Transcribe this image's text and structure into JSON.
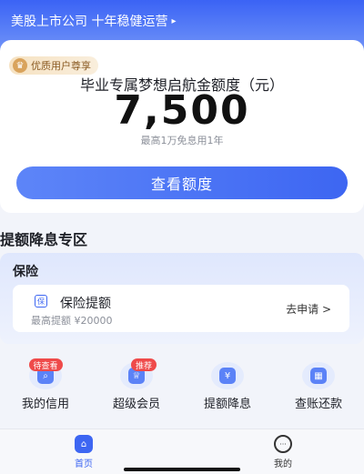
{
  "banner": {
    "text": "美股上市公司 十年稳健运营",
    "arrow": "▸"
  },
  "quota_card": {
    "badge": "优质用户尊享",
    "title": "毕业专属梦想启航金额度（元）",
    "amount": "7,500",
    "subtitle": "最高1万免息用1年",
    "button": "查看额度"
  },
  "section": {
    "title": "提额降息专区"
  },
  "insurance": {
    "panel_title": "保险",
    "item_name": "保险提额",
    "max_text": "最高提额 ¥20000",
    "apply": "去申请 >"
  },
  "quick_actions": [
    {
      "label": "我的信用",
      "badge": "待查看",
      "icon": "search-icon"
    },
    {
      "label": "超级会员",
      "badge": "推荐",
      "icon": "crown-icon"
    },
    {
      "label": "提额降息",
      "badge": "",
      "icon": "yen-icon"
    },
    {
      "label": "查账还款",
      "badge": "",
      "icon": "calendar-icon"
    }
  ],
  "tabbar": {
    "home": "首页",
    "mine": "我的"
  },
  "colors": {
    "accent": "#3d66f2",
    "badge_red": "#ef4a4a"
  }
}
